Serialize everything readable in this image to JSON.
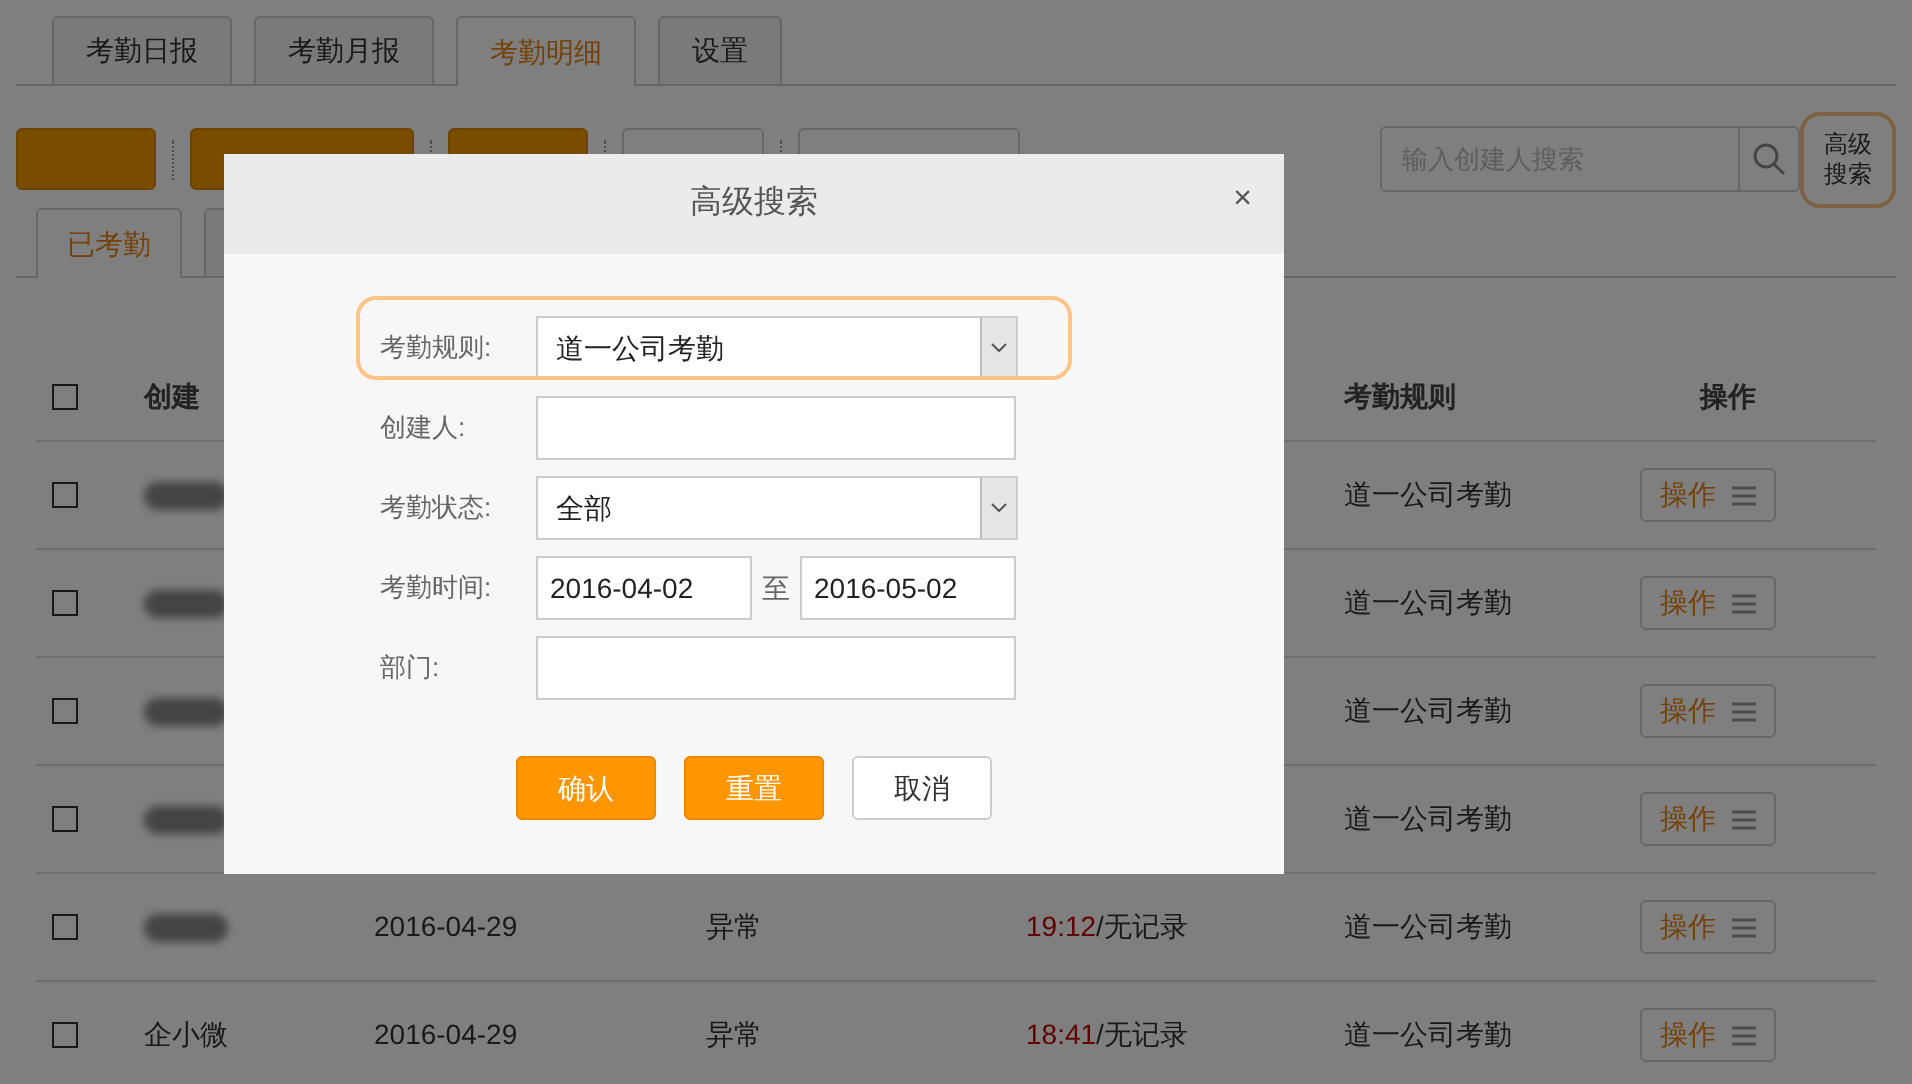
{
  "tabs": [
    {
      "label": "考勤日报",
      "selected": false
    },
    {
      "label": "考勤月报",
      "selected": false
    },
    {
      "label": "考勤明细",
      "selected": true
    },
    {
      "label": "设置",
      "selected": false
    }
  ],
  "toolbar": {
    "buttons": [
      {
        "kind": "primary"
      },
      {
        "kind": "primary"
      },
      {
        "kind": "primary"
      },
      {
        "kind": "default"
      },
      {
        "kind": "default"
      }
    ],
    "search": {
      "placeholder": "输入创建人搜索"
    },
    "advanced_button": {
      "label": "高级搜索",
      "highlighted": true
    }
  },
  "sub_tabs": [
    {
      "label": "已考勤",
      "selected": true
    },
    {
      "selected": false
    }
  ],
  "table": {
    "columns": [
      "创建",
      "考勤规则",
      "操作"
    ],
    "header_checked": false,
    "rows": [
      {
        "checked": false,
        "creator_blurred": true,
        "rule": "道一公司考勤",
        "action": "操作"
      },
      {
        "checked": false,
        "creator_blurred": true,
        "rule": "道一公司考勤",
        "action": "操作"
      },
      {
        "checked": false,
        "creator_blurred": true,
        "rule": "道一公司考勤",
        "action": "操作"
      },
      {
        "checked": false,
        "creator_blurred": true,
        "rule": "道一公司考勤",
        "action": "操作"
      },
      {
        "checked": false,
        "creator_blurred": true,
        "date": "2016-04-29",
        "status": "异常",
        "time": "19:12",
        "time_note": "/无记录",
        "rule": "道一公司考勤",
        "action": "操作"
      },
      {
        "checked": false,
        "creator_blurred": false,
        "creator": "企小微",
        "date": "2016-04-29",
        "status": "异常",
        "time": "18:41",
        "time_note": "/无记录",
        "rule": "道一公司考勤",
        "action": "操作"
      }
    ]
  },
  "dialog": {
    "title": "高级搜索",
    "close": "×",
    "fields": [
      {
        "kind": "select",
        "label": "考勤规则:",
        "value": "道一公司考勤",
        "highlighted": true
      },
      {
        "kind": "text",
        "label": "创建人:",
        "highlighted": false
      },
      {
        "kind": "select",
        "label": "考勤状态:",
        "value": "全部",
        "highlighted": false
      },
      {
        "kind": "range",
        "label": "考勤时间:",
        "from": "2016-04-02",
        "separator": "至",
        "to": "2016-05-02",
        "highlighted": false
      },
      {
        "kind": "text",
        "label": "部门:",
        "highlighted": false
      }
    ],
    "buttons": [
      {
        "label": "确认",
        "kind": "primary"
      },
      {
        "label": "重置",
        "kind": "primary"
      },
      {
        "label": "取消",
        "kind": "default"
      }
    ]
  }
}
